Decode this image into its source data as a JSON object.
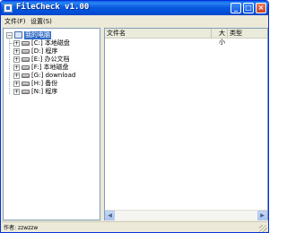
{
  "window": {
    "title": "FileCheck v1.00",
    "buttons": {
      "minimize": "_",
      "maximize": "□",
      "close": "×"
    }
  },
  "menu": {
    "file": "文件(F)",
    "settings": "设置(S)"
  },
  "tree": {
    "root": {
      "label": "我的电脑",
      "icon": "computer-icon",
      "expander": "−"
    },
    "drives": [
      {
        "label": "[C:] 本地磁盘",
        "expander": "+"
      },
      {
        "label": "[D:] 程序",
        "expander": "+"
      },
      {
        "label": "[E:] 办公文档",
        "expander": "+"
      },
      {
        "label": "[F:] 本地磁盘",
        "expander": "+"
      },
      {
        "label": "[G:] download",
        "expander": "+"
      },
      {
        "label": "[H:] 备份",
        "expander": "+"
      },
      {
        "label": "[N:] 程序",
        "expander": "+"
      }
    ]
  },
  "list": {
    "columns": [
      "文件名",
      "大小",
      "类型"
    ],
    "rows": []
  },
  "scrollbar": {
    "left": "◀",
    "right": "▶"
  },
  "status": {
    "text": "作者: zzwzzw"
  },
  "colors": {
    "titlebar": "#0a5ae0",
    "selection": "#316ac5",
    "window_bg": "#ece9d8"
  }
}
